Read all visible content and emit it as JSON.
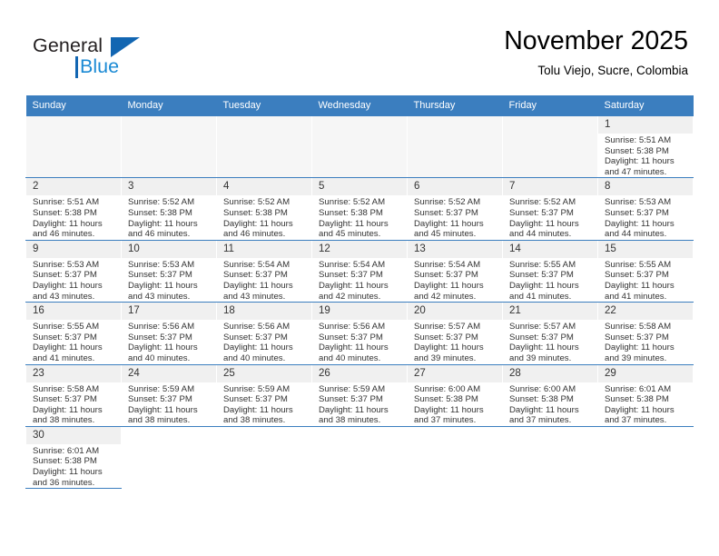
{
  "logo": {
    "word1": "General",
    "word2": "Blue",
    "triangle_color": "#1266b2",
    "blue_color": "#1b8ad4"
  },
  "header": {
    "title": "November 2025",
    "location": "Tolu Viejo, Sucre, Colombia"
  },
  "colors": {
    "header_row": "#3b7ebf",
    "daynum_bg": "#f0f0f0",
    "empty_cell": "#f6f6f6",
    "text": "#333333"
  },
  "weekday_headers": [
    "Sunday",
    "Monday",
    "Tuesday",
    "Wednesday",
    "Thursday",
    "Friday",
    "Saturday"
  ],
  "labels": {
    "sunrise": "Sunrise:",
    "sunset": "Sunset:",
    "daylight": "Daylight:"
  },
  "weeks": [
    [
      {
        "empty": true
      },
      {
        "empty": true
      },
      {
        "empty": true
      },
      {
        "empty": true
      },
      {
        "empty": true
      },
      {
        "empty": true
      },
      {
        "day": "1",
        "sunrise": "Sunrise: 5:51 AM",
        "sunset": "Sunset: 5:38 PM",
        "daylight1": "Daylight: 11 hours",
        "daylight2": "and 47 minutes."
      }
    ],
    [
      {
        "day": "2",
        "sunrise": "Sunrise: 5:51 AM",
        "sunset": "Sunset: 5:38 PM",
        "daylight1": "Daylight: 11 hours",
        "daylight2": "and 46 minutes."
      },
      {
        "day": "3",
        "sunrise": "Sunrise: 5:52 AM",
        "sunset": "Sunset: 5:38 PM",
        "daylight1": "Daylight: 11 hours",
        "daylight2": "and 46 minutes."
      },
      {
        "day": "4",
        "sunrise": "Sunrise: 5:52 AM",
        "sunset": "Sunset: 5:38 PM",
        "daylight1": "Daylight: 11 hours",
        "daylight2": "and 46 minutes."
      },
      {
        "day": "5",
        "sunrise": "Sunrise: 5:52 AM",
        "sunset": "Sunset: 5:38 PM",
        "daylight1": "Daylight: 11 hours",
        "daylight2": "and 45 minutes."
      },
      {
        "day": "6",
        "sunrise": "Sunrise: 5:52 AM",
        "sunset": "Sunset: 5:37 PM",
        "daylight1": "Daylight: 11 hours",
        "daylight2": "and 45 minutes."
      },
      {
        "day": "7",
        "sunrise": "Sunrise: 5:52 AM",
        "sunset": "Sunset: 5:37 PM",
        "daylight1": "Daylight: 11 hours",
        "daylight2": "and 44 minutes."
      },
      {
        "day": "8",
        "sunrise": "Sunrise: 5:53 AM",
        "sunset": "Sunset: 5:37 PM",
        "daylight1": "Daylight: 11 hours",
        "daylight2": "and 44 minutes."
      }
    ],
    [
      {
        "day": "9",
        "sunrise": "Sunrise: 5:53 AM",
        "sunset": "Sunset: 5:37 PM",
        "daylight1": "Daylight: 11 hours",
        "daylight2": "and 43 minutes."
      },
      {
        "day": "10",
        "sunrise": "Sunrise: 5:53 AM",
        "sunset": "Sunset: 5:37 PM",
        "daylight1": "Daylight: 11 hours",
        "daylight2": "and 43 minutes."
      },
      {
        "day": "11",
        "sunrise": "Sunrise: 5:54 AM",
        "sunset": "Sunset: 5:37 PM",
        "daylight1": "Daylight: 11 hours",
        "daylight2": "and 43 minutes."
      },
      {
        "day": "12",
        "sunrise": "Sunrise: 5:54 AM",
        "sunset": "Sunset: 5:37 PM",
        "daylight1": "Daylight: 11 hours",
        "daylight2": "and 42 minutes."
      },
      {
        "day": "13",
        "sunrise": "Sunrise: 5:54 AM",
        "sunset": "Sunset: 5:37 PM",
        "daylight1": "Daylight: 11 hours",
        "daylight2": "and 42 minutes."
      },
      {
        "day": "14",
        "sunrise": "Sunrise: 5:55 AM",
        "sunset": "Sunset: 5:37 PM",
        "daylight1": "Daylight: 11 hours",
        "daylight2": "and 41 minutes."
      },
      {
        "day": "15",
        "sunrise": "Sunrise: 5:55 AM",
        "sunset": "Sunset: 5:37 PM",
        "daylight1": "Daylight: 11 hours",
        "daylight2": "and 41 minutes."
      }
    ],
    [
      {
        "day": "16",
        "sunrise": "Sunrise: 5:55 AM",
        "sunset": "Sunset: 5:37 PM",
        "daylight1": "Daylight: 11 hours",
        "daylight2": "and 41 minutes."
      },
      {
        "day": "17",
        "sunrise": "Sunrise: 5:56 AM",
        "sunset": "Sunset: 5:37 PM",
        "daylight1": "Daylight: 11 hours",
        "daylight2": "and 40 minutes."
      },
      {
        "day": "18",
        "sunrise": "Sunrise: 5:56 AM",
        "sunset": "Sunset: 5:37 PM",
        "daylight1": "Daylight: 11 hours",
        "daylight2": "and 40 minutes."
      },
      {
        "day": "19",
        "sunrise": "Sunrise: 5:56 AM",
        "sunset": "Sunset: 5:37 PM",
        "daylight1": "Daylight: 11 hours",
        "daylight2": "and 40 minutes."
      },
      {
        "day": "20",
        "sunrise": "Sunrise: 5:57 AM",
        "sunset": "Sunset: 5:37 PM",
        "daylight1": "Daylight: 11 hours",
        "daylight2": "and 39 minutes."
      },
      {
        "day": "21",
        "sunrise": "Sunrise: 5:57 AM",
        "sunset": "Sunset: 5:37 PM",
        "daylight1": "Daylight: 11 hours",
        "daylight2": "and 39 minutes."
      },
      {
        "day": "22",
        "sunrise": "Sunrise: 5:58 AM",
        "sunset": "Sunset: 5:37 PM",
        "daylight1": "Daylight: 11 hours",
        "daylight2": "and 39 minutes."
      }
    ],
    [
      {
        "day": "23",
        "sunrise": "Sunrise: 5:58 AM",
        "sunset": "Sunset: 5:37 PM",
        "daylight1": "Daylight: 11 hours",
        "daylight2": "and 38 minutes."
      },
      {
        "day": "24",
        "sunrise": "Sunrise: 5:59 AM",
        "sunset": "Sunset: 5:37 PM",
        "daylight1": "Daylight: 11 hours",
        "daylight2": "and 38 minutes."
      },
      {
        "day": "25",
        "sunrise": "Sunrise: 5:59 AM",
        "sunset": "Sunset: 5:37 PM",
        "daylight1": "Daylight: 11 hours",
        "daylight2": "and 38 minutes."
      },
      {
        "day": "26",
        "sunrise": "Sunrise: 5:59 AM",
        "sunset": "Sunset: 5:37 PM",
        "daylight1": "Daylight: 11 hours",
        "daylight2": "and 38 minutes."
      },
      {
        "day": "27",
        "sunrise": "Sunrise: 6:00 AM",
        "sunset": "Sunset: 5:38 PM",
        "daylight1": "Daylight: 11 hours",
        "daylight2": "and 37 minutes."
      },
      {
        "day": "28",
        "sunrise": "Sunrise: 6:00 AM",
        "sunset": "Sunset: 5:38 PM",
        "daylight1": "Daylight: 11 hours",
        "daylight2": "and 37 minutes."
      },
      {
        "day": "29",
        "sunrise": "Sunrise: 6:01 AM",
        "sunset": "Sunset: 5:38 PM",
        "daylight1": "Daylight: 11 hours",
        "daylight2": "and 37 minutes."
      }
    ],
    [
      {
        "day": "30",
        "sunrise": "Sunrise: 6:01 AM",
        "sunset": "Sunset: 5:38 PM",
        "daylight1": "Daylight: 11 hours",
        "daylight2": "and 36 minutes."
      },
      {
        "blank": true
      },
      {
        "blank": true
      },
      {
        "blank": true
      },
      {
        "blank": true
      },
      {
        "blank": true
      },
      {
        "blank": true
      }
    ]
  ]
}
